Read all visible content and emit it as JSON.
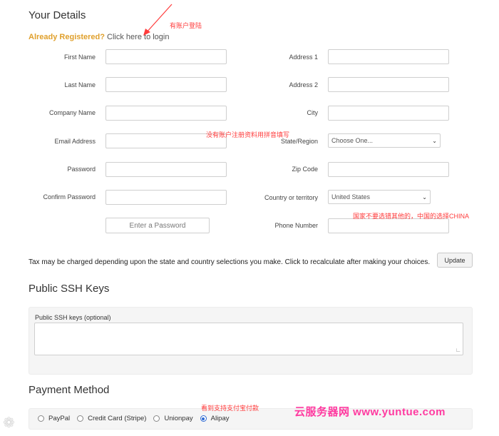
{
  "details": {
    "title": "Your Details",
    "already_q": "Already Registered?",
    "login_link": "Click here to login"
  },
  "left_fields": [
    {
      "label": "First Name",
      "value": ""
    },
    {
      "label": "Last Name",
      "value": ""
    },
    {
      "label": "Company Name",
      "value": ""
    },
    {
      "label": "Email Address",
      "value": ""
    },
    {
      "label": "Password",
      "value": ""
    },
    {
      "label": "Confirm Password",
      "value": ""
    }
  ],
  "password_button": "Enter a Password",
  "right_fields": {
    "address1": "Address 1",
    "address2": "Address 2",
    "city": "City",
    "state": "State/Region",
    "state_value": "Choose One...",
    "zip": "Zip Code",
    "country": "Country or territory",
    "country_value": "United States",
    "phone": "Phone Number"
  },
  "tax_note": "Tax may be charged depending upon the state and country selections you make. Click to recalculate after making your choices.",
  "update_label": "Update",
  "ssh": {
    "title": "Public SSH Keys",
    "label": "Public SSH keys (optional)",
    "value": ""
  },
  "payment": {
    "title": "Payment Method",
    "options": [
      "PayPal",
      "Credit Card (Stripe)",
      "Unionpay",
      "Alipay"
    ],
    "selected": "Alipay"
  },
  "annotations": {
    "login_note": "有账户登陆",
    "register_note": "没有账户注册资料用拼音填写",
    "country_note": "国家不要选错其他的，中国的选择CHINA",
    "pay_note": "看到支持支付宝付款"
  },
  "watermark": "云服务器网 www.yuntue.com",
  "colors": {
    "accent_orange": "#e0a02c",
    "annotation_red": "#ff3b3b",
    "watermark_pink": "#ff3aa0",
    "radio_blue": "#2f6bd3"
  }
}
